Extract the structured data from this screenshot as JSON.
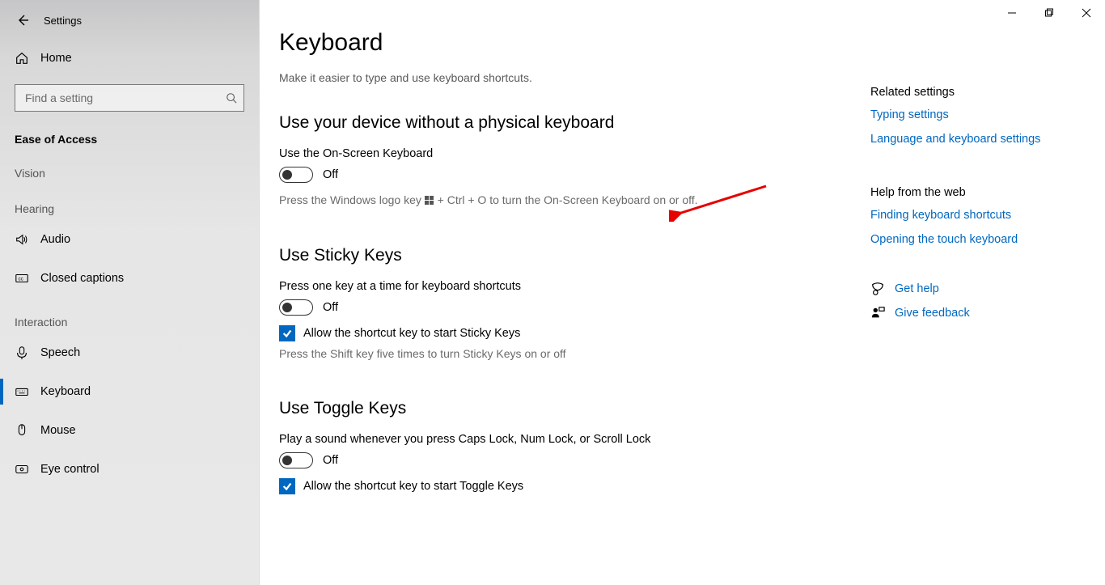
{
  "window": {
    "title": "Settings"
  },
  "sidebar": {
    "home": "Home",
    "search_placeholder": "Find a setting",
    "category": "Ease of Access",
    "group1": "Vision",
    "group2": "Hearing",
    "group3": "Interaction",
    "items": {
      "audio": "Audio",
      "cc": "Closed captions",
      "speech": "Speech",
      "keyboard": "Keyboard",
      "mouse": "Mouse",
      "eye": "Eye control"
    }
  },
  "page": {
    "title": "Keyboard",
    "subtitle": "Make it easier to type and use keyboard shortcuts."
  },
  "sections": {
    "no_physical": {
      "heading": "Use your device without a physical keyboard",
      "osk_label": "Use the On-Screen Keyboard",
      "osk_state": "Off",
      "hint_before": "Press the Windows logo key ",
      "hint_after": " + Ctrl + O to turn the On-Screen Keyboard on or off."
    },
    "sticky": {
      "heading": "Use Sticky Keys",
      "label": "Press one key at a time for keyboard shortcuts",
      "state": "Off",
      "check_label": "Allow the shortcut key to start Sticky Keys",
      "hint": "Press the Shift key five times to turn Sticky Keys on or off"
    },
    "toggle": {
      "heading": "Use Toggle Keys",
      "label": "Play a sound whenever you press Caps Lock, Num Lock, or Scroll Lock",
      "state": "Off",
      "check_label": "Allow the shortcut key to start Toggle Keys"
    }
  },
  "info": {
    "related_head": "Related settings",
    "link_typing": "Typing settings",
    "link_lang": "Language and keyboard settings",
    "help_head": "Help from the web",
    "link_shortcuts": "Finding keyboard shortcuts",
    "link_touch": "Opening the touch keyboard",
    "get_help": "Get help",
    "feedback": "Give feedback"
  }
}
